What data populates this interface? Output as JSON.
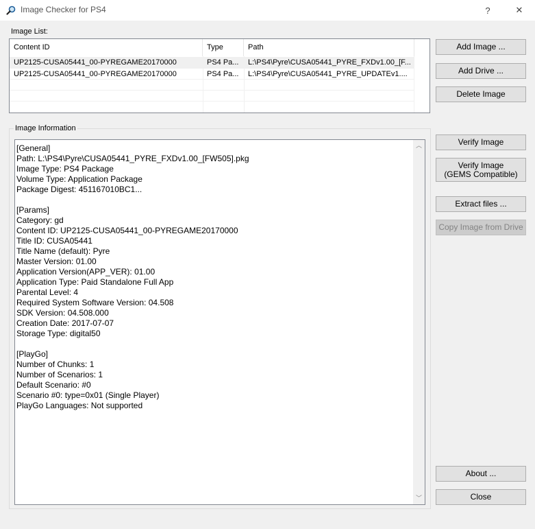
{
  "window": {
    "title": "Image Checker for PS4",
    "help": "?",
    "close": "✕"
  },
  "image_list": {
    "label": "Image List:",
    "columns": [
      "Content ID",
      "Type",
      "Path"
    ],
    "rows": [
      {
        "content_id": "UP2125-CUSA05441_00-PYREGAME20170000",
        "type": "PS4 Pa...",
        "path": "L:\\PS4\\Pyre\\CUSA05441_PYRE_FXDv1.00_[F..."
      },
      {
        "content_id": "UP2125-CUSA05441_00-PYREGAME20170000",
        "type": "PS4 Pa...",
        "path": "L:\\PS4\\Pyre\\CUSA05441_PYRE_UPDATEv1...."
      }
    ]
  },
  "image_info": {
    "label": "Image Information",
    "text": "[General]\nPath: L:\\PS4\\Pyre\\CUSA05441_PYRE_FXDv1.00_[FW505].pkg\nImage Type: PS4 Package\nVolume Type: Application Package\nPackage Digest: 451167010BC1...\n\n[Params]\nCategory: gd\nContent ID: UP2125-CUSA05441_00-PYREGAME20170000\nTitle ID: CUSA05441\nTitle Name (default): Pyre\nMaster Version: 01.00\nApplication Version(APP_VER): 01.00\nApplication Type: Paid Standalone Full App\nParental Level: 4\nRequired System Software Version: 04.508\nSDK Version: 04.508.000\nCreation Date: 2017-07-07\nStorage Type: digital50\n\n[PlayGo]\nNumber of Chunks: 1\nNumber of Scenarios: 1\nDefault Scenario: #0\nScenario #0: type=0x01 (Single Player)\nPlayGo Languages: Not supported"
  },
  "buttons": {
    "add_image": "Add Image ...",
    "add_drive": "Add Drive ...",
    "delete_image": "Delete Image",
    "verify_image": "Verify Image",
    "verify_gems_line1": "Verify Image",
    "verify_gems_line2": "(GEMS Compatible)",
    "extract_files": "Extract files ...",
    "copy_from_drive": "Copy Image from Drive",
    "about": "About ...",
    "close": "Close"
  }
}
